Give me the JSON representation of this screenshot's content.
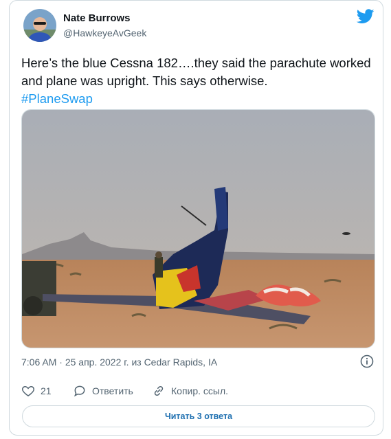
{
  "author": {
    "name": "Nate Burrows",
    "handle": "@HawkeyeAvGeek"
  },
  "tweet": {
    "text": "Here’s the blue Cessna 182….they said the parachute worked and plane was upright. This says otherwise.",
    "hashtag": "#PlaneSwap"
  },
  "meta": {
    "time": "7:06 AM",
    "separator": "·",
    "date": "25 апр. 2022 г.",
    "location": "из Cedar Rapids, IA"
  },
  "actions": {
    "likes_count": "21",
    "reply_label": "Ответить",
    "copy_link_label": "Копир. ссыл."
  },
  "replies_button": {
    "label": "Читать 3 ответа"
  },
  "colors": {
    "brand": "#1d9bf0",
    "text": "#0f1419",
    "secondary": "#536471",
    "border": "#cfd9de"
  },
  "icons": {
    "logo": "twitter-bird-icon",
    "info": "info-icon",
    "like": "heart-icon",
    "reply": "speech-bubble-icon",
    "copy": "link-icon"
  }
}
